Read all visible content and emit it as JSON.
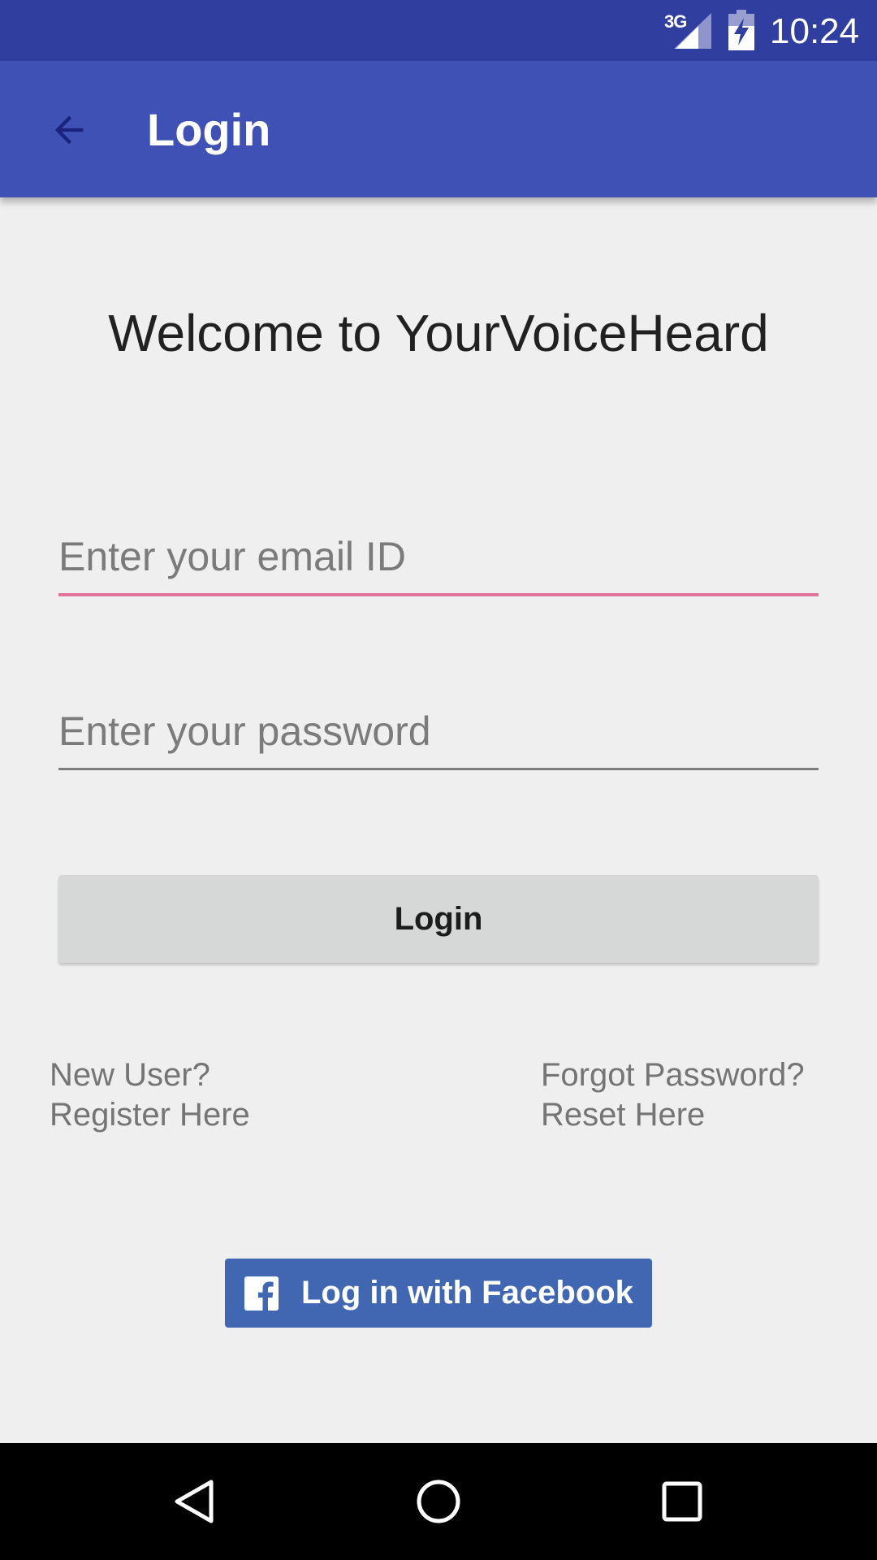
{
  "status_bar": {
    "network": "3G",
    "time": "10:24",
    "signal_icon": "cell-signal-icon",
    "battery_icon": "battery-charging-icon"
  },
  "app_bar": {
    "title": "Login",
    "back_icon": "arrow-back-icon",
    "color": "#3f51b5"
  },
  "welcome": "Welcome to YourVoiceHeard",
  "form": {
    "email_placeholder": "Enter your email ID",
    "password_placeholder": "Enter your password",
    "login_label": "Login"
  },
  "links": {
    "new_user": "New User?",
    "register": "Register Here",
    "forgot": "Forgot Password?",
    "reset": "Reset Here"
  },
  "facebook": {
    "label": "Log in with Facebook",
    "icon": "facebook-icon",
    "color": "#4267b2"
  },
  "nav_bar": {
    "back_icon": "nav-back-icon",
    "home_icon": "nav-home-icon",
    "recents_icon": "nav-recents-icon"
  }
}
